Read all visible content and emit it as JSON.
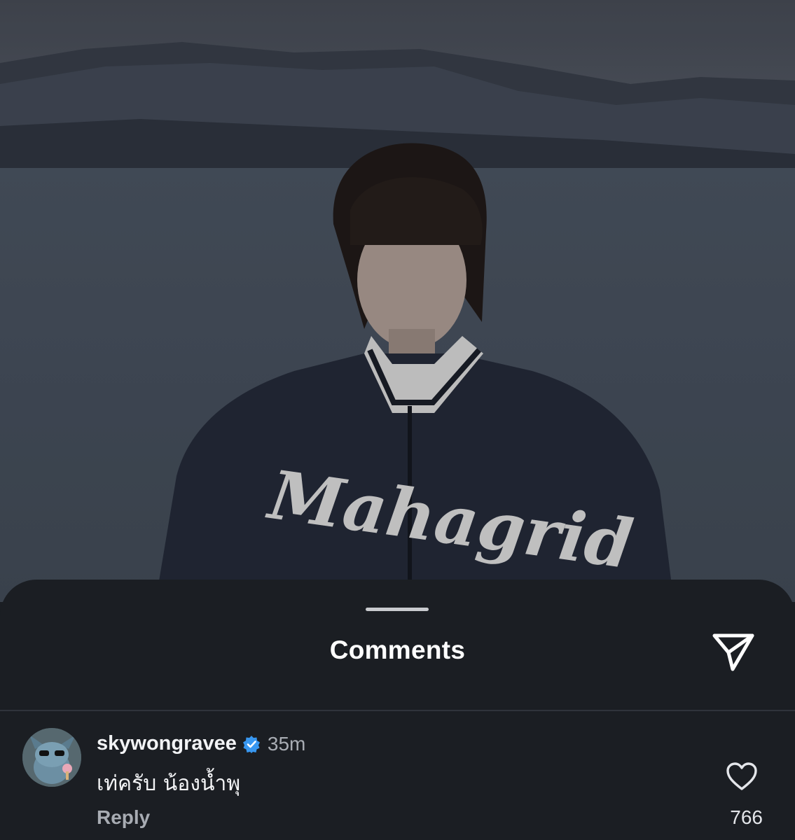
{
  "post": {
    "image_description_icon": "photo-background",
    "jacket_text": "Mahagrid"
  },
  "comments_sheet": {
    "title": "Comments",
    "share_icon": "paper-plane-icon"
  },
  "comment": {
    "username": "skywongravee",
    "verified_icon": "verified-badge-icon",
    "time": "35m",
    "text": "เท่ครับ น้องน้ำพุ",
    "reply_label": "Reply",
    "like_icon": "heart-outline-icon",
    "like_count": "766"
  },
  "colors": {
    "sheet_background": "#1b1e23",
    "verified_blue": "#3897f0",
    "secondary_text": "#a8acb3"
  }
}
